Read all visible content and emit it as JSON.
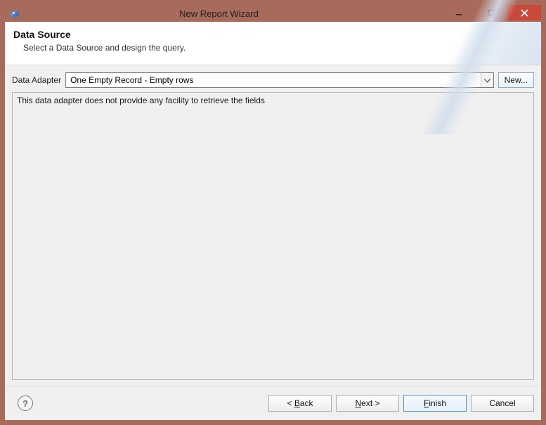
{
  "window": {
    "title": "New Report Wizard"
  },
  "banner": {
    "heading": "Data Source",
    "subtext": "Select a Data Source and design the query."
  },
  "adapter": {
    "label": "Data Adapter",
    "selected": "One Empty Record - Empty rows",
    "new_button": "New..."
  },
  "info": {
    "message": "This data adapter does not provide any facility to retrieve the fields"
  },
  "footer": {
    "help_tooltip": "Help",
    "back_prefix": "< ",
    "back_label": "Back",
    "next_label": "Next",
    "next_suffix": " >",
    "finish_label": "Finish",
    "cancel_label": "Cancel"
  }
}
